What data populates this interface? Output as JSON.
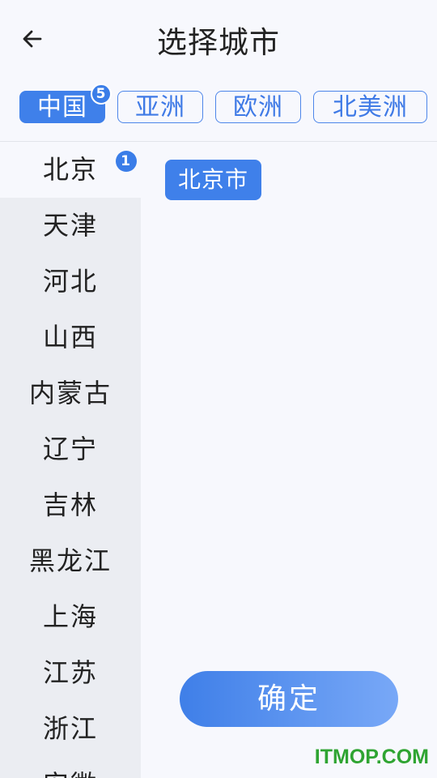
{
  "header": {
    "title": "选择城市",
    "back_icon": "arrow-left-icon"
  },
  "tabs": [
    {
      "label": "中国",
      "active": true,
      "badge": "5"
    },
    {
      "label": "亚洲",
      "active": false
    },
    {
      "label": "欧洲",
      "active": false
    },
    {
      "label": "北美洲",
      "active": false
    }
  ],
  "provinces": [
    {
      "label": "北京",
      "active": true,
      "badge": "1"
    },
    {
      "label": "天津"
    },
    {
      "label": "河北"
    },
    {
      "label": "山西"
    },
    {
      "label": "内蒙古"
    },
    {
      "label": "辽宁"
    },
    {
      "label": "吉林"
    },
    {
      "label": "黑龙江"
    },
    {
      "label": "上海"
    },
    {
      "label": "江苏"
    },
    {
      "label": "浙江"
    },
    {
      "label": "安徽"
    }
  ],
  "cities": [
    {
      "label": "北京市",
      "selected": true
    }
  ],
  "confirm_label": "确定",
  "watermark": "ITMOP.COM",
  "colors": {
    "accent": "#3f80ea",
    "background": "#f7f8fd",
    "sidebar": "#ebedf2",
    "watermark": "#2fa432"
  }
}
